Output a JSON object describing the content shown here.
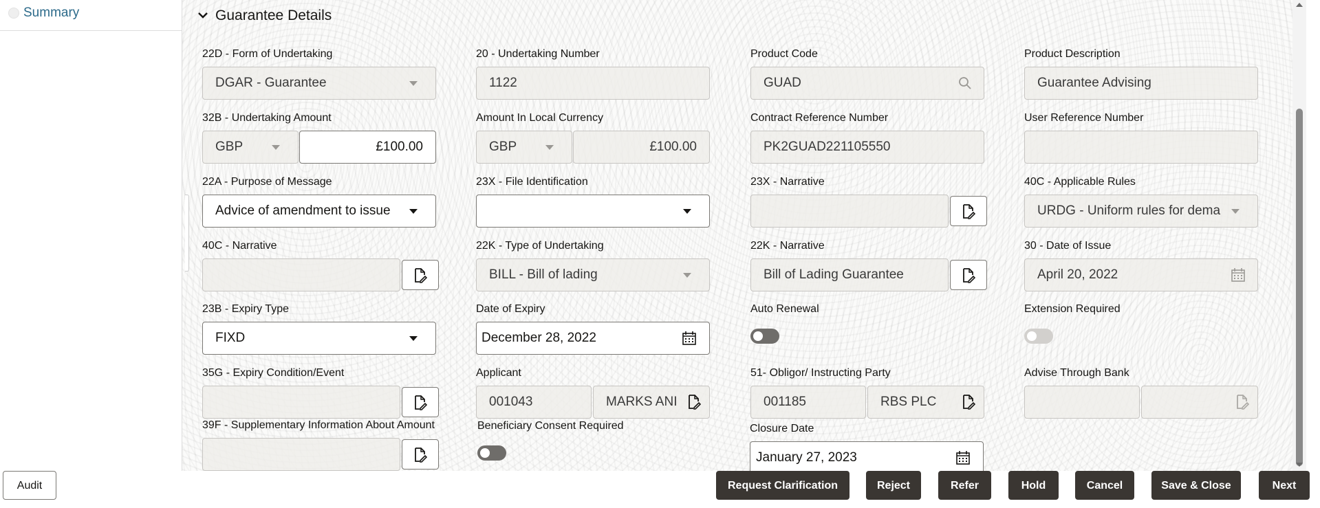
{
  "sidebar": {
    "items": [
      {
        "label": "Summary"
      }
    ]
  },
  "section": {
    "title": "Guarantee Details"
  },
  "fields": {
    "form_of_undertaking": {
      "label": "22D - Form of Undertaking",
      "value": "DGAR - Guarantee"
    },
    "undertaking_number": {
      "label": "20 - Undertaking Number",
      "value": "1122"
    },
    "product_code": {
      "label": "Product Code",
      "value": "GUAD"
    },
    "product_description": {
      "label": "Product Description",
      "value": "Guarantee Advising"
    },
    "undertaking_amount": {
      "label": "32B - Undertaking Amount",
      "currency": "GBP",
      "amount": "£100.00"
    },
    "amount_local": {
      "label": "Amount In Local Currency",
      "currency": "GBP",
      "amount": "£100.00"
    },
    "contract_reference": {
      "label": "Contract Reference Number",
      "value": "PK2GUAD221105550"
    },
    "user_reference": {
      "label": "User Reference Number",
      "value": ""
    },
    "purpose_of_message": {
      "label": "22A - Purpose of Message",
      "value": "Advice of amendment to issue"
    },
    "file_identification": {
      "label": "23X - File Identification",
      "value": ""
    },
    "narrative_23x": {
      "label": "23X - Narrative",
      "value": ""
    },
    "applicable_rules": {
      "label": "40C - Applicable Rules",
      "value": "URDG - Uniform rules for dema"
    },
    "narrative_40c": {
      "label": "40C - Narrative",
      "value": ""
    },
    "type_of_undertaking": {
      "label": "22K - Type of Undertaking",
      "value": "BILL - Bill of lading"
    },
    "narrative_22k": {
      "label": "22K - Narrative",
      "value": "Bill of Lading Guarantee"
    },
    "date_of_issue": {
      "label": "30 - Date of Issue",
      "value": "April 20, 2022"
    },
    "expiry_type": {
      "label": "23B - Expiry Type",
      "value": "FIXD"
    },
    "date_of_expiry": {
      "label": "Date of Expiry",
      "value": "December 28, 2022"
    },
    "auto_renewal": {
      "label": "Auto Renewal",
      "state": "off"
    },
    "extension_required": {
      "label": "Extension Required",
      "state": "off-disabled"
    },
    "expiry_condition": {
      "label": "35G - Expiry Condition/Event",
      "value": ""
    },
    "applicant": {
      "label": "Applicant",
      "id": "001043",
      "name": "MARKS ANI"
    },
    "obligor": {
      "label": "51- Obligor/ Instructing Party",
      "id": "001185",
      "name": "RBS PLC"
    },
    "advise_through_bank": {
      "label": "Advise Through Bank",
      "id": "",
      "name": ""
    },
    "supplementary_info": {
      "label": "39F - Supplementary Information About Amount",
      "value": ""
    },
    "beneficiary_consent": {
      "label": "Beneficiary Consent Required",
      "state": "off"
    },
    "closure_date": {
      "label": "Closure Date",
      "value": "January 27, 2023"
    }
  },
  "footer": {
    "audit": "Audit",
    "request_clarification": "Request Clarification",
    "reject": "Reject",
    "refer": "Refer",
    "hold": "Hold",
    "cancel": "Cancel",
    "save_close": "Save & Close",
    "next": "Next"
  },
  "colors": {
    "primary_button": "#3a3632",
    "link": "#2c6a8a"
  }
}
